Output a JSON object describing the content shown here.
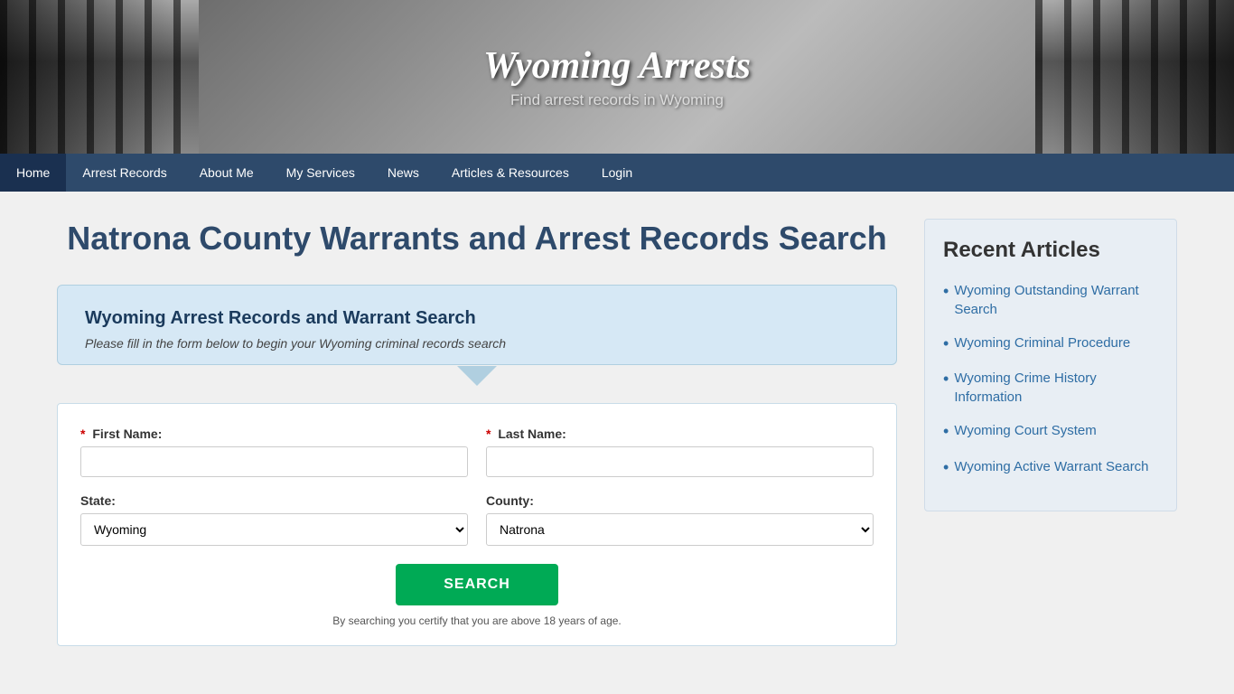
{
  "site": {
    "title": "Wyoming Arrests",
    "tagline": "Find arrest records in Wyoming"
  },
  "nav": {
    "items": [
      {
        "label": "Home",
        "active": false
      },
      {
        "label": "Arrest Records",
        "active": false
      },
      {
        "label": "About Me",
        "active": false
      },
      {
        "label": "My Services",
        "active": false
      },
      {
        "label": "News",
        "active": false
      },
      {
        "label": "Articles & Resources",
        "active": false
      },
      {
        "label": "Login",
        "active": false
      }
    ]
  },
  "main": {
    "page_title": "Natrona County Warrants and Arrest Records Search",
    "form": {
      "box_title": "Wyoming Arrest Records and Warrant Search",
      "box_subtitle": "Please fill in the form below to begin your Wyoming criminal records search",
      "first_name_label": "First Name:",
      "last_name_label": "Last Name:",
      "state_label": "State:",
      "county_label": "County:",
      "state_value": "Wyoming",
      "county_value": "Natrona",
      "state_options": [
        "Wyoming"
      ],
      "county_options": [
        "Natrona"
      ],
      "search_button": "SEARCH",
      "disclaimer": "By searching you certify that you are above 18 years of age."
    }
  },
  "sidebar": {
    "title": "Recent Articles",
    "articles": [
      {
        "label": "Wyoming Outstanding Warrant Search"
      },
      {
        "label": "Wyoming Criminal Procedure"
      },
      {
        "label": "Wyoming Crime History Information"
      },
      {
        "label": "Wyoming Court System"
      },
      {
        "label": "Wyoming Active Warrant Search"
      }
    ]
  }
}
